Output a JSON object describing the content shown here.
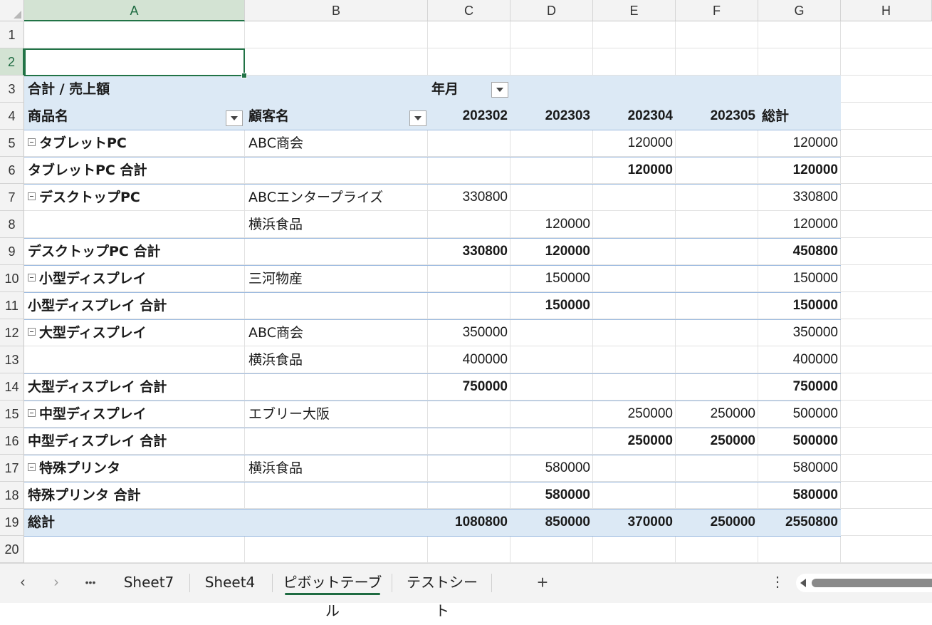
{
  "columns": [
    "A",
    "B",
    "C",
    "D",
    "E",
    "F",
    "G",
    "H"
  ],
  "rows": [
    "1",
    "2",
    "3",
    "4",
    "5",
    "6",
    "7",
    "8",
    "9",
    "10",
    "11",
    "12",
    "13",
    "14",
    "15",
    "16",
    "17",
    "18",
    "19",
    "20"
  ],
  "active_cell": "A2",
  "pivot": {
    "header_row3": {
      "value_label": "合計 / 売上額",
      "column_field": "年月"
    },
    "header_row4": {
      "row_field_1": "商品名",
      "row_field_2": "顧客名",
      "months": [
        "202302",
        "202303",
        "202304",
        "202305"
      ],
      "grand_total_label": "総計"
    },
    "body": [
      {
        "type": "item",
        "product": "タブレットPC",
        "customer": "ABC商会",
        "c": "",
        "d": "",
        "e": "120000",
        "f": "",
        "g": "120000"
      },
      {
        "type": "subtotal",
        "product": "タブレットPC 合計",
        "customer": "",
        "c": "",
        "d": "",
        "e": "120000",
        "f": "",
        "g": "120000"
      },
      {
        "type": "item",
        "product": "デスクトップPC",
        "customer": "ABCエンタープライズ",
        "c": "330800",
        "d": "",
        "e": "",
        "f": "",
        "g": "330800"
      },
      {
        "type": "detail",
        "product": "",
        "customer": "横浜食品",
        "c": "",
        "d": "120000",
        "e": "",
        "f": "",
        "g": "120000"
      },
      {
        "type": "subtotal",
        "product": "デスクトップPC 合計",
        "customer": "",
        "c": "330800",
        "d": "120000",
        "e": "",
        "f": "",
        "g": "450800"
      },
      {
        "type": "item",
        "product": "小型ディスプレイ",
        "customer": "三河物産",
        "c": "",
        "d": "150000",
        "e": "",
        "f": "",
        "g": "150000"
      },
      {
        "type": "subtotal",
        "product": "小型ディスプレイ 合計",
        "customer": "",
        "c": "",
        "d": "150000",
        "e": "",
        "f": "",
        "g": "150000"
      },
      {
        "type": "item",
        "product": "大型ディスプレイ",
        "customer": "ABC商会",
        "c": "350000",
        "d": "",
        "e": "",
        "f": "",
        "g": "350000"
      },
      {
        "type": "detail",
        "product": "",
        "customer": "横浜食品",
        "c": "400000",
        "d": "",
        "e": "",
        "f": "",
        "g": "400000"
      },
      {
        "type": "subtotal",
        "product": "大型ディスプレイ 合計",
        "customer": "",
        "c": "750000",
        "d": "",
        "e": "",
        "f": "",
        "g": "750000"
      },
      {
        "type": "item",
        "product": "中型ディスプレイ",
        "customer": "エブリー大阪",
        "c": "",
        "d": "",
        "e": "250000",
        "f": "250000",
        "g": "500000"
      },
      {
        "type": "subtotal",
        "product": "中型ディスプレイ 合計",
        "customer": "",
        "c": "",
        "d": "",
        "e": "250000",
        "f": "250000",
        "g": "500000"
      },
      {
        "type": "item",
        "product": "特殊プリンタ",
        "customer": "横浜食品",
        "c": "",
        "d": "580000",
        "e": "",
        "f": "",
        "g": "580000"
      },
      {
        "type": "subtotal",
        "product": "特殊プリンタ 合計",
        "customer": "",
        "c": "",
        "d": "580000",
        "e": "",
        "f": "",
        "g": "580000"
      },
      {
        "type": "grand",
        "product": "総計",
        "customer": "",
        "c": "1080800",
        "d": "850000",
        "e": "370000",
        "f": "250000",
        "g": "2550800"
      }
    ]
  },
  "tabbar": {
    "nav_prev": "‹",
    "nav_next": "›",
    "more": "•••",
    "tabs": [
      "Sheet7",
      "Sheet4",
      "ピボットテーブル",
      "テストシート"
    ],
    "active_tab": "ピボットテーブル",
    "add": "+",
    "menu": "⋮"
  },
  "colors": {
    "pivot_header_fill": "#dce9f5",
    "selection_green": "#217346"
  }
}
